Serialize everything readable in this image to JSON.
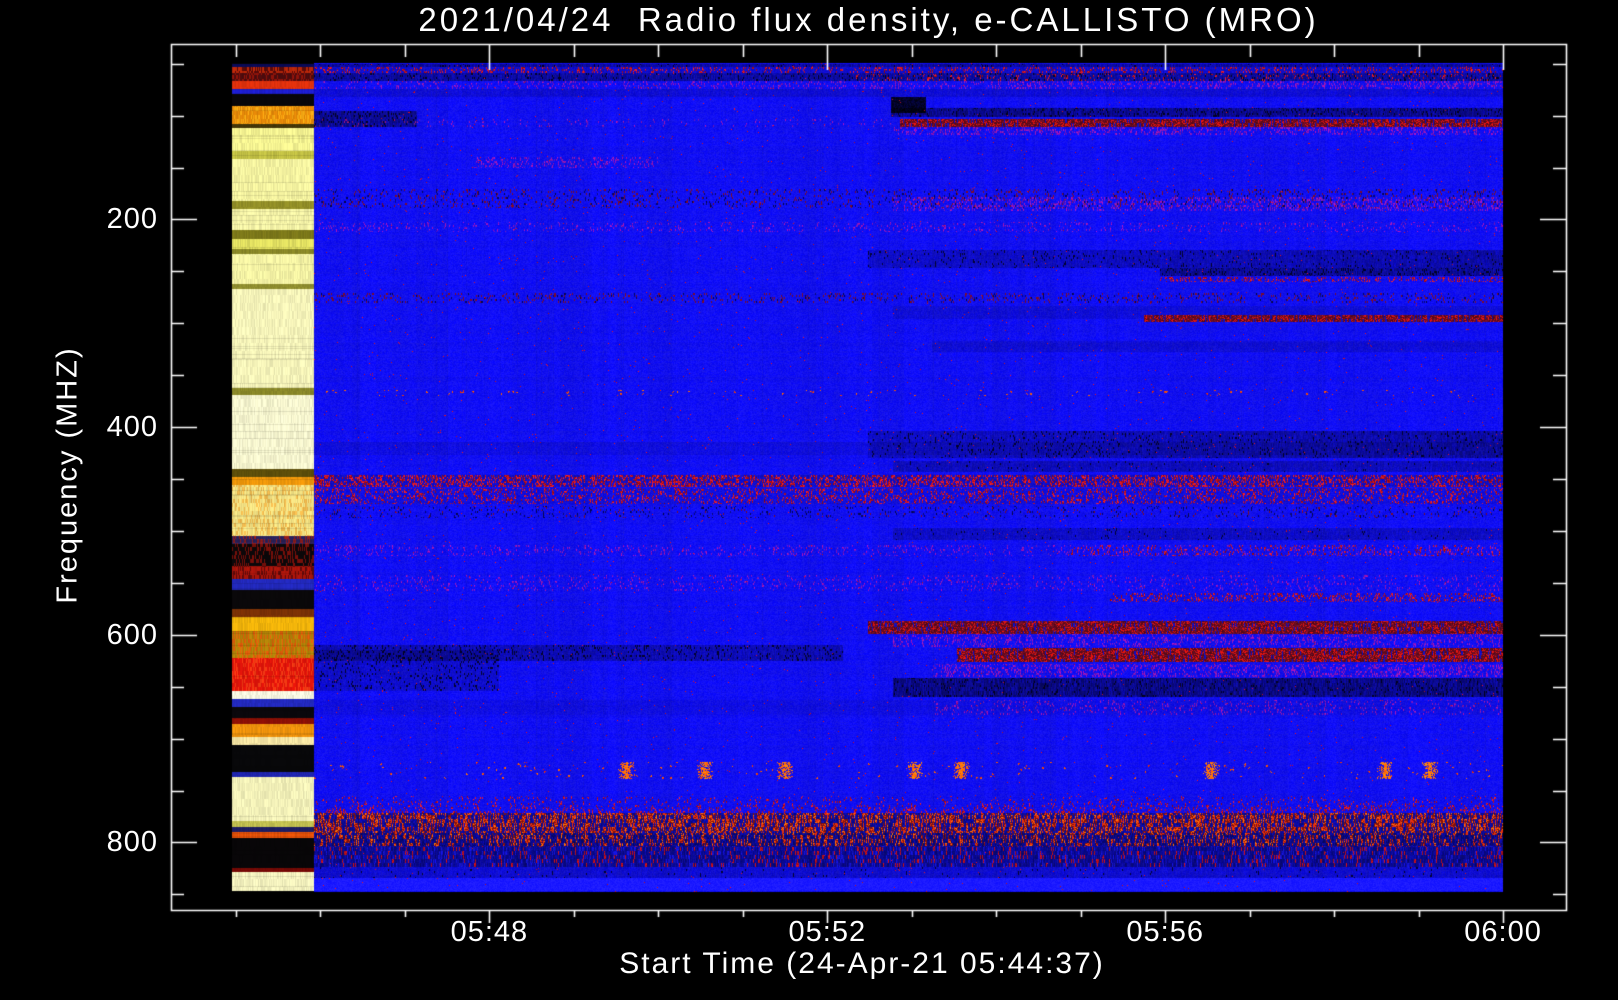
{
  "chart_data": {
    "type": "heatmap",
    "subtype": "radio-spectrogram",
    "title": "2021/04/24  Radio flux density, e-CALLISTO (MRO)",
    "xlabel": "Start Time (24-Apr-21 05:44:37)",
    "ylabel": "Frequency (MHZ)",
    "x_ticks": [
      "05:48",
      "05:52",
      "05:56",
      "06:00"
    ],
    "x_minor_tick_interval": "1 minute",
    "y_ticks": [
      200,
      400,
      600,
      800
    ],
    "y_minor_tick_interval_mhz": 50,
    "y_axis_direction": "frequency increases downward",
    "x_start_time": "05:44:37",
    "x_end_tick": "06:00",
    "freq_axis_top_mhz": 45,
    "freq_axis_bottom_mhz": 850,
    "legend": "none",
    "grid": "off",
    "palette": {
      "background": "#000000",
      "frame_and_text": "#ffffff",
      "base_quiet_sky": "#1414e6",
      "dark_band": "#000055",
      "rfi_red": "#cc2200",
      "rfi_bright_orange": "#ff7010",
      "saturated_yellow": "#ffffa8",
      "saturated_cream": "#ffffd8",
      "saturated_orange": "#f09000",
      "saturated_red": "#e81008"
    },
    "features_summary": [
      "Saturated multicolour calibration/overload band during first ~minute (until ~05:45:40) covering all frequencies",
      "Quiet blue background over most of the spectrogram with vertical scintillation streaks",
      "Narrowband RFI stripes (dark and red rows) near 55-115 MHz, 170-300 MHz, 445-475 MHz, 585-660 MHz",
      "Activity increases after ~05:53 on the right half: red emission stripes near 105, 295, 590, 615 MHz and dark absorption bands near 95, 235, 410-430, 645 MHz",
      "Broadband terrestrial RFI band ~755-845 MHz with dense red speckle across the whole time range",
      "Row of sparse bright orange bursts near 725-740 MHz"
    ],
    "left_saturated_band": {
      "t0_frac": 0.0,
      "t1_frac": 0.0645,
      "stripes": [
        {
          "f0": 49.3,
          "f1": 52.2,
          "c": [
            10,
            10,
            90
          ]
        },
        {
          "f0": 52.2,
          "f1": 58.9,
          "c": [
            190,
            40,
            10
          ],
          "c2": [
            90,
            10,
            10
          ]
        },
        {
          "f0": 58.9,
          "f1": 66.6,
          "c": [
            80,
            12,
            14
          ],
          "c2": [
            150,
            20,
            10
          ]
        },
        {
          "f0": 66.6,
          "f1": 73.4,
          "c": [
            230,
            50,
            12
          ]
        },
        {
          "f0": 73.4,
          "f1": 79.1,
          "c": [
            30,
            30,
            215
          ]
        },
        {
          "f0": 79.1,
          "f1": 90.7,
          "c": [
            8,
            6,
            10
          ]
        },
        {
          "f0": 90.7,
          "f1": 107.1,
          "c": [
            235,
            140,
            8
          ],
          "c2": [
            255,
            175,
            20
          ]
        },
        {
          "f0": 107.1,
          "f1": 111.9,
          "c": [
            70,
            56,
            8
          ]
        },
        {
          "f0": 111.9,
          "f1": 133.1,
          "c": [
            252,
            250,
            150
          ]
        },
        {
          "f0": 133.1,
          "f1": 140.8,
          "c": [
            200,
            198,
            70
          ]
        },
        {
          "f0": 140.8,
          "f1": 182.2,
          "c": [
            252,
            250,
            165
          ]
        },
        {
          "f0": 182.2,
          "f1": 189.9,
          "c": [
            150,
            146,
            40
          ]
        },
        {
          "f0": 189.9,
          "f1": 209.2,
          "c": [
            252,
            250,
            172
          ]
        },
        {
          "f0": 209.2,
          "f1": 218.8,
          "c": [
            128,
            124,
            26
          ]
        },
        {
          "f0": 218.8,
          "f1": 228.4,
          "c": [
            232,
            230,
            100
          ]
        },
        {
          "f0": 228.4,
          "f1": 232.3,
          "c": [
            140,
            138,
            40
          ]
        },
        {
          "f0": 232.3,
          "f1": 261.2,
          "c": [
            250,
            248,
            168
          ]
        },
        {
          "f0": 261.2,
          "f1": 266.0,
          "c": [
            148,
            146,
            48
          ]
        },
        {
          "f0": 266.0,
          "f1": 362.3,
          "c": [
            252,
            250,
            190
          ]
        },
        {
          "f0": 362.3,
          "f1": 368.1,
          "c": [
            142,
            140,
            42
          ]
        },
        {
          "f0": 368.1,
          "f1": 440.3,
          "c": [
            253,
            252,
            212
          ]
        },
        {
          "f0": 440.3,
          "f1": 448.0,
          "c": [
            95,
            80,
            10
          ]
        },
        {
          "f0": 448.0,
          "f1": 455.7,
          "c": [
            245,
            155,
            10
          ]
        },
        {
          "f0": 455.7,
          "f1": 504.8,
          "c": [
            250,
            232,
            135
          ],
          "c2": [
            245,
            190,
            80
          ]
        },
        {
          "f0": 504.8,
          "f1": 511.6,
          "c": [
            45,
            35,
            95
          ],
          "c2": [
            150,
            30,
            30
          ]
        },
        {
          "f0": 511.6,
          "f1": 533.7,
          "c": [
            12,
            8,
            10
          ],
          "c2": [
            120,
            16,
            10
          ]
        },
        {
          "f0": 533.7,
          "f1": 546.2,
          "c": [
            175,
            22,
            12
          ],
          "c2": [
            100,
            10,
            10
          ]
        },
        {
          "f0": 546.2,
          "f1": 555.9,
          "c": [
            35,
            42,
            195
          ]
        },
        {
          "f0": 555.9,
          "f1": 575.1,
          "c": [
            10,
            8,
            10
          ]
        },
        {
          "f0": 575.1,
          "f1": 582.8,
          "c": [
            125,
            50,
            5
          ]
        },
        {
          "f0": 582.8,
          "f1": 595.4,
          "c": [
            248,
            185,
            10
          ]
        },
        {
          "f0": 595.4,
          "f1": 621.4,
          "c": [
            185,
            135,
            8
          ],
          "c2": [
            230,
            95,
            10
          ]
        },
        {
          "f0": 621.4,
          "f1": 653.2,
          "c": [
            230,
            20,
            10
          ],
          "c2": [
            250,
            60,
            20
          ]
        },
        {
          "f0": 653.2,
          "f1": 661.8,
          "c": [
            253,
            252,
            228
          ]
        },
        {
          "f0": 661.8,
          "f1": 669.5,
          "c": [
            35,
            42,
            195
          ]
        },
        {
          "f0": 669.5,
          "f1": 679.2,
          "c": [
            10,
            8,
            12
          ]
        },
        {
          "f0": 679.2,
          "f1": 685.9,
          "c": [
            145,
            16,
            5
          ]
        },
        {
          "f0": 685.9,
          "f1": 698.4,
          "c": [
            245,
            150,
            12
          ]
        },
        {
          "f0": 698.4,
          "f1": 705.2,
          "c": [
            252,
            235,
            168
          ]
        },
        {
          "f0": 705.2,
          "f1": 731.2,
          "c": [
            8,
            8,
            10
          ]
        },
        {
          "f0": 731.2,
          "f1": 736.0,
          "c": [
            32,
            38,
            180
          ]
        },
        {
          "f0": 736.0,
          "f1": 778.4,
          "c": [
            250,
            248,
            190
          ]
        },
        {
          "f0": 778.4,
          "f1": 785.1,
          "c": [
            198,
            196,
            82
          ]
        },
        {
          "f0": 785.1,
          "f1": 789.0,
          "c": [
            30,
            30,
            100
          ]
        },
        {
          "f0": 789.0,
          "f1": 794.8,
          "c": [
            240,
            85,
            8
          ]
        },
        {
          "f0": 794.8,
          "f1": 823.7,
          "c": [
            8,
            6,
            8
          ]
        },
        {
          "f0": 823.7,
          "f1": 827.5,
          "c": [
            120,
            10,
            5
          ]
        },
        {
          "f0": 827.5,
          "f1": 845.8,
          "c": [
            250,
            248,
            195
          ]
        }
      ]
    },
    "main_bands": [
      {
        "f0": 49.3,
        "f1": 53.1,
        "x0": 0.064,
        "x1": 1,
        "k": "dark",
        "s": 0.45,
        "sp": 0.2
      },
      {
        "f0": 53.1,
        "f1": 58.9,
        "x0": 0.064,
        "x1": 1,
        "k": "red",
        "d": 0.22,
        "bg": 0.35
      },
      {
        "f0": 58.9,
        "f1": 66.6,
        "x0": 0.064,
        "x1": 1,
        "k": "dark",
        "s": 0.45,
        "sp": 0.35
      },
      {
        "f0": 59.5,
        "f1": 66.6,
        "x0": 0.49,
        "x1": 1,
        "k": "red",
        "d": 0.12,
        "bg": 0
      },
      {
        "f0": 66.6,
        "f1": 74.3,
        "x0": 0.064,
        "x1": 1,
        "k": "purple",
        "d": 0.3,
        "ramp": 1
      },
      {
        "f0": 74.3,
        "f1": 82,
        "x0": 0.064,
        "x1": 1,
        "k": "dark",
        "s": 0.18,
        "sp": 0
      },
      {
        "f0": 92.6,
        "f1": 101.3,
        "x0": 0.518,
        "x1": 1,
        "k": "dark",
        "s": 0.55,
        "sp": 0.5
      },
      {
        "f0": 82,
        "f1": 96.5,
        "x0": 0.518,
        "x1": 0.546,
        "k": "blackblob"
      },
      {
        "f0": 94.6,
        "f1": 110,
        "x0": 0.064,
        "x1": 0.145,
        "k": "dark",
        "s": 0.5,
        "sp": 0.5
      },
      {
        "f0": 102.3,
        "f1": 110,
        "x0": 0.064,
        "x1": 0.525,
        "k": "purple",
        "d": 0.06
      },
      {
        "f0": 102.3,
        "f1": 110,
        "x0": 0.525,
        "x1": 1,
        "k": "redstripe",
        "d": 0.55
      },
      {
        "f0": 110,
        "f1": 117.7,
        "x0": 0.52,
        "x1": 1,
        "k": "purple",
        "d": 0.28
      },
      {
        "f0": 139.8,
        "f1": 149.5,
        "x0": 0.19,
        "x1": 0.335,
        "k": "purple",
        "d": 0.22
      },
      {
        "f0": 169.7,
        "f1": 188,
        "x0": 0.064,
        "x1": 1,
        "k": "speck",
        "s": 0.18,
        "d": 0.08
      },
      {
        "f0": 177.4,
        "f1": 190.9,
        "x0": 0.52,
        "x1": 1,
        "k": "purple",
        "d": 0.25
      },
      {
        "f0": 202.4,
        "f1": 212,
        "x0": 0.064,
        "x1": 1,
        "k": "purple",
        "d": 0.1
      },
      {
        "f0": 229.4,
        "f1": 245.8,
        "x0": 0.5,
        "x1": 1,
        "k": "dark",
        "s": 0.42,
        "sp": 0.25,
        "ramp": 1
      },
      {
        "f0": 246.7,
        "f1": 254.4,
        "x0": 0.73,
        "x1": 1,
        "k": "dark",
        "s": 0.5,
        "sp": 0.6
      },
      {
        "f0": 255.4,
        "f1": 259.3,
        "x0": 0.73,
        "x1": 1,
        "k": "red",
        "d": 0.3,
        "bg": 0.1
      },
      {
        "f0": 270.8,
        "f1": 279.5,
        "x0": 0.064,
        "x1": 1,
        "k": "speck",
        "s": 0.15,
        "d": 0.1
      },
      {
        "f0": 282.4,
        "f1": 294.9,
        "x0": 0.52,
        "x1": 1,
        "k": "dark",
        "s": 0.16,
        "sp": 0
      },
      {
        "f0": 292,
        "f1": 298.7,
        "x0": 0.717,
        "x1": 1,
        "k": "redstripe",
        "d": 0.5
      },
      {
        "f0": 316.1,
        "f1": 327.6,
        "x0": 0.55,
        "x1": 1,
        "k": "dark",
        "s": 0.16,
        "sp": 0
      },
      {
        "f0": 364.2,
        "f1": 370,
        "x0": 0.064,
        "x1": 1,
        "k": "dots",
        "d": 0.05
      },
      {
        "f0": 402.8,
        "f1": 429.7,
        "x0": 0.5,
        "x1": 1,
        "k": "dark",
        "s": 0.45,
        "sp": 0.3,
        "ramp": 1
      },
      {
        "f0": 414.3,
        "f1": 426.8,
        "x0": 0.064,
        "x1": 1,
        "k": "dark",
        "s": 0.12,
        "sp": 0
      },
      {
        "f0": 431.7,
        "f1": 443.2,
        "x0": 0.52,
        "x1": 1,
        "k": "dark",
        "s": 0.3,
        "sp": 0.1
      },
      {
        "f0": 445.2,
        "f1": 456.7,
        "x0": 0.064,
        "x1": 1,
        "k": "red",
        "d": 0.4,
        "bg": 0.45
      },
      {
        "f0": 458.6,
        "f1": 473.1,
        "x0": 0.064,
        "x1": 1,
        "k": "red",
        "d": 0.22,
        "bg": 0.2
      },
      {
        "f0": 475,
        "f1": 487.5,
        "x0": 0.064,
        "x1": 1,
        "k": "speck",
        "s": 0.22,
        "d": 0.03
      },
      {
        "f0": 496.2,
        "f1": 508.7,
        "x0": 0.52,
        "x1": 1,
        "k": "dark",
        "s": 0.26,
        "sp": 0.1
      },
      {
        "f0": 513.5,
        "f1": 524.1,
        "x0": 0.064,
        "x1": 1,
        "k": "purple",
        "d": 0.12
      },
      {
        "f0": 513.5,
        "f1": 524.1,
        "x0": 0.66,
        "x1": 1,
        "k": "red",
        "d": 0.14,
        "bg": 0
      },
      {
        "f0": 542.4,
        "f1": 556.9,
        "x0": 0.064,
        "x1": 1,
        "k": "purple",
        "d": 0.1
      },
      {
        "f0": 558.8,
        "f1": 568.4,
        "x0": 0.69,
        "x1": 1,
        "k": "red",
        "d": 0.25,
        "bg": 0.1
      },
      {
        "f0": 585.8,
        "f1": 599.2,
        "x0": 0.5,
        "x1": 1,
        "k": "redstripe",
        "d": 0.45
      },
      {
        "f0": 599.2,
        "f1": 611.7,
        "x0": 0.52,
        "x1": 1,
        "k": "purple",
        "d": 0.22
      },
      {
        "f0": 609.8,
        "f1": 624.3,
        "x0": 0.064,
        "x1": 0.48,
        "k": "dark",
        "s": 0.35,
        "sp": 0.45
      },
      {
        "f0": 612.7,
        "f1": 626.2,
        "x0": 0.57,
        "x1": 1,
        "k": "redstripe",
        "d": 0.62
      },
      {
        "f0": 627.2,
        "f1": 639.7,
        "x0": 0.55,
        "x1": 1,
        "k": "purple",
        "d": 0.28
      },
      {
        "f0": 641.6,
        "f1": 659,
        "x0": 0.52,
        "x1": 1,
        "k": "dark",
        "s": 0.62,
        "sp": 0.3
      },
      {
        "f0": 614.6,
        "f1": 653.2,
        "x0": 0.02,
        "x1": 0.21,
        "k": "dark",
        "s": 0.22,
        "sp": 0.35
      },
      {
        "f0": 662.8,
        "f1": 676.3,
        "x0": 0.064,
        "x1": 1,
        "k": "dark",
        "s": 0.1,
        "sp": 0
      },
      {
        "f0": 662.8,
        "f1": 676.3,
        "x0": 0.55,
        "x1": 1,
        "k": "purple",
        "d": 0.12
      },
      {
        "f0": 722.5,
        "f1": 738,
        "x0": 0.064,
        "x1": 1,
        "k": "dots",
        "d": 0.03,
        "blobs": [
          0.31,
          0.372,
          0.435,
          0.537,
          0.573,
          0.77,
          0.907,
          0.942
        ]
      },
      {
        "f0": 754.3,
        "f1": 770.7,
        "x0": 0.064,
        "x1": 1,
        "k": "red",
        "d": 0.2,
        "bg": 0.05,
        "rampy": 1
      },
      {
        "f0": 770.7,
        "f1": 790,
        "x0": 0.064,
        "x1": 1,
        "k": "redband",
        "d": 0.5,
        "bg": 0.5
      },
      {
        "f0": 790,
        "f1": 803.4,
        "x0": 0.064,
        "x1": 1,
        "k": "redband",
        "d": 0.3,
        "bg": 0.62
      },
      {
        "f0": 803.4,
        "f1": 822.7,
        "x0": 0.064,
        "x1": 1,
        "k": "darkmix",
        "s": 0.55
      },
      {
        "f0": 822.7,
        "f1": 833.3,
        "x0": 0.064,
        "x1": 1,
        "k": "dark",
        "s": 0.2,
        "sp": 0.1
      },
      {
        "f0": 833.3,
        "f1": 845.8,
        "x0": 0.064,
        "x1": 1,
        "k": "bright"
      }
    ]
  }
}
